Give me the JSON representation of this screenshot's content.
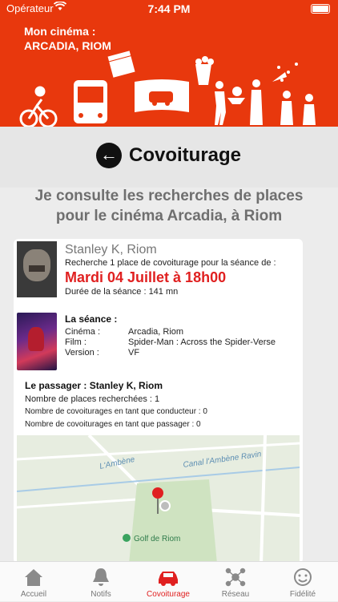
{
  "status_bar": {
    "carrier": "Opérateur",
    "time": "7:44 PM"
  },
  "header": {
    "cinema_label": "Mon cinéma :",
    "cinema_name": "ARCADIA, RIOM"
  },
  "title_bar": {
    "title": "Covoiturage"
  },
  "subtitle": {
    "line1": "Je consulte les recherches de places",
    "line2": "pour le cinéma Arcadia, à Riom"
  },
  "request": {
    "user_name": "Stanley K, Riom",
    "request_text": "Recherche 1 place de covoiturage pour la séance de :",
    "session_date": "Mardi 04 Juillet à 18h00",
    "duration": "Durée de la séance : 141 mn"
  },
  "seance": {
    "heading": "La séance :",
    "rows": [
      {
        "label": "Cinéma :",
        "value": "Arcadia, Riom"
      },
      {
        "label": "Film :",
        "value": "Spider-Man : Across the Spider-Verse"
      },
      {
        "label": "Version :",
        "value": "VF"
      }
    ]
  },
  "passenger": {
    "heading": "Le passager : Stanley K, Riom",
    "places": "Nombre de places recherchées : 1",
    "as_driver": "Nombre de covoiturages en tant que conducteur : 0",
    "as_passenger": "Nombre de covoiturages en tant que passager : 0"
  },
  "map": {
    "road_label_1": "L'Ambène",
    "road_label_2": "Canal l'Ambène Ravin",
    "poi_label": "Golf de Riom"
  },
  "tabs": [
    {
      "label": "Accueil",
      "icon": "home-icon",
      "active": false
    },
    {
      "label": "Notifs",
      "icon": "bell-icon",
      "active": false
    },
    {
      "label": "Covoiturage",
      "icon": "car-icon",
      "active": true
    },
    {
      "label": "Réseau",
      "icon": "network-icon",
      "active": false
    },
    {
      "label": "Fidélité",
      "icon": "smiley-icon",
      "active": false
    }
  ],
  "colors": {
    "brand": "#e8380d",
    "accent": "#e02020"
  }
}
